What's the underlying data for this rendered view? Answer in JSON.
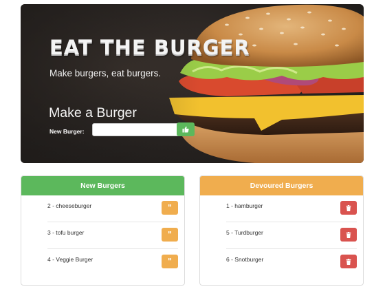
{
  "hero": {
    "title": "EAT THE BURGER",
    "tagline": "Make burgers, eat burgers.",
    "form_heading": "Make a Burger",
    "input_label": "New Burger:",
    "input_value": "",
    "submit_icon": "thumbs-up-icon"
  },
  "colors": {
    "success": "#5cb85c",
    "warning": "#f0ad4e",
    "danger": "#d9534f"
  },
  "new_burgers": {
    "title": "New Burgers",
    "items": [
      {
        "label": "2 -  cheeseburger",
        "action_icon": "quote-icon"
      },
      {
        "label": "3 -  tofu burger",
        "action_icon": "quote-icon"
      },
      {
        "label": "4 -  Veggie Burger",
        "action_icon": "quote-icon"
      }
    ]
  },
  "devoured_burgers": {
    "title": "Devoured Burgers",
    "items": [
      {
        "label": "1 - hamburger",
        "action_icon": "trash-icon"
      },
      {
        "label": "5 - Turdburger",
        "action_icon": "trash-icon"
      },
      {
        "label": "6 - Snotburger",
        "action_icon": "trash-icon"
      }
    ]
  }
}
